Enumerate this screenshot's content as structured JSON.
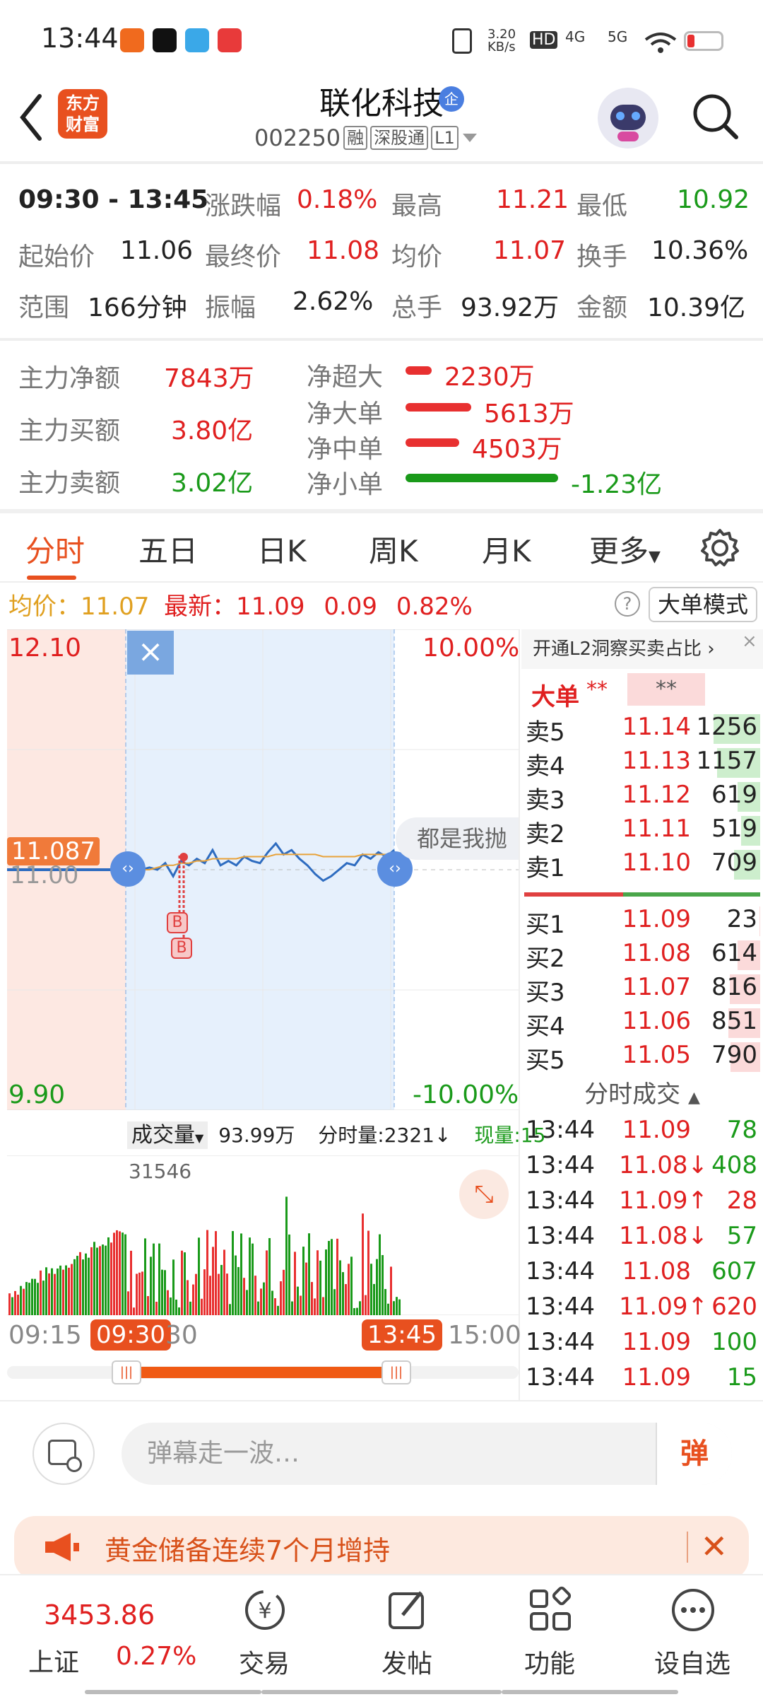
{
  "status_bar": {
    "time": "13:44",
    "speed": "3.20\nKB/s",
    "network": "4G",
    "network2": "5G"
  },
  "header": {
    "back_icon": "chevron-left-icon",
    "logo_text": "东方\n财富",
    "stock_name": "联化科技",
    "qi_badge": "企",
    "stock_code": "002250",
    "tags": [
      "融",
      "深股通",
      "L1"
    ],
    "search_icon": "search-icon"
  },
  "range_info": {
    "time_range": "09:30 - 13:45",
    "rows": [
      [
        {
          "label": "涨跌幅",
          "value": "0.18%",
          "color": "red"
        },
        {
          "label": "最高",
          "value": "11.21",
          "color": "red"
        },
        {
          "label": "最低",
          "value": "10.92",
          "color": "green"
        }
      ],
      [
        {
          "label": "起始价",
          "value": "11.06",
          "color": "dark"
        },
        {
          "label": "最终价",
          "value": "11.08",
          "color": "red"
        },
        {
          "label": "均价",
          "value": "11.07",
          "color": "red"
        },
        {
          "label": "换手",
          "value": "10.36%",
          "color": "dark"
        }
      ],
      [
        {
          "label": "范围",
          "value": "166分钟",
          "color": "dark"
        },
        {
          "label": "振幅",
          "value": "2.62%",
          "color": "dark"
        },
        {
          "label": "总手",
          "value": "93.92万",
          "color": "dark"
        },
        {
          "label": "金额",
          "value": "10.39亿",
          "color": "dark"
        }
      ]
    ]
  },
  "capital_flow": {
    "main_net_label": "主力净额",
    "main_net": "7843万",
    "main_buy_label": "主力买额",
    "main_buy": "3.80亿",
    "main_sell_label": "主力卖额",
    "main_sell": "3.02亿",
    "bars": [
      {
        "label": "净超大",
        "value": "2230万",
        "color": "#e83030",
        "level": 0.17
      },
      {
        "label": "净大单",
        "value": "5613万",
        "color": "#e83030",
        "level": 0.43
      },
      {
        "label": "净中单",
        "value": "4503万",
        "color": "#e83030",
        "level": 0.35
      },
      {
        "label": "净小单",
        "value": "-1.23亿",
        "color": "#1a9a1a",
        "level": 1.0
      }
    ]
  },
  "tabs": [
    "分时",
    "五日",
    "日K",
    "周K",
    "月K",
    "更多"
  ],
  "active_tab": "分时",
  "settings_icon": "gear-icon",
  "quote_line": {
    "avg_label": "均价：",
    "avg_value": "11.07",
    "latest_label": "最新：",
    "latest_value": "11.09",
    "change": "0.09",
    "change_pct": "0.82%",
    "big_order_mode": "大单模式"
  },
  "chart": {
    "y_top": "12.10",
    "y_bottom": "9.90",
    "pct_top": "10.00%",
    "pct_bottom": "-10.00%",
    "current_price_tag": "11.087",
    "mid_price": "11.00",
    "tooltip": "都是我抛",
    "buy_markers": [
      "B",
      "B"
    ]
  },
  "chart_data": {
    "type": "line",
    "title": "",
    "series": [
      {
        "values": [
          11.0,
          11.0,
          11.0,
          11.01,
          11.0,
          11.03,
          10.97,
          11.04,
          11.02,
          11.05,
          11.03,
          11.09,
          11.02,
          11.04,
          11.02,
          11.06,
          11.04,
          11.03,
          11.08,
          11.12,
          11.07,
          11.09,
          11.05,
          11.02,
          10.98,
          10.95,
          10.97,
          11.0,
          11.03,
          11.02,
          11.07,
          11.05,
          11.08,
          11.06,
          11.09
        ]
      },
      {
        "values": [
          11.0,
          11.0,
          11.0,
          11.0,
          11.01,
          11.02,
          11.02,
          11.03,
          11.03,
          11.04,
          11.04,
          11.05,
          11.05,
          11.05,
          11.05,
          11.06,
          11.06,
          11.06,
          11.06,
          11.07,
          11.07,
          11.07,
          11.07,
          11.07,
          11.07,
          11.06,
          11.06,
          11.06,
          11.06,
          11.06,
          11.07,
          11.07,
          11.07,
          11.07,
          11.07
        ]
      }
    ],
    "ylim": [
      9.9,
      12.1
    ]
  },
  "volume": {
    "label": "成交量",
    "total": "93.99万",
    "tick_vol_label": "分时量:2321↓",
    "now_vol_label": "现量:15",
    "peak_label": "31546",
    "expand_icon": "expand-icon"
  },
  "time_axis": {
    "start": "09:15",
    "sel_start": "09:30",
    "sel_start_tail": "30",
    "sel_end": "13:45",
    "end": "15:00"
  },
  "order_book": {
    "l2_banner": "开通L2洞察买卖占比",
    "big_label": "大单",
    "big_value1": "**",
    "big_value2": "**",
    "asks": [
      {
        "label": "卖5",
        "price": "11.14",
        "vol": "1256",
        "level": 1.0
      },
      {
        "label": "卖4",
        "price": "11.13",
        "vol": "1157",
        "level": 0.92
      },
      {
        "label": "卖3",
        "price": "11.12",
        "vol": "619",
        "level": 0.49
      },
      {
        "label": "卖2",
        "price": "11.11",
        "vol": "519",
        "level": 0.41
      },
      {
        "label": "卖1",
        "price": "11.10",
        "vol": "709",
        "level": 0.56
      }
    ],
    "bids": [
      {
        "label": "买1",
        "price": "11.09",
        "vol": "23",
        "level": 0.02
      },
      {
        "label": "买2",
        "price": "11.08",
        "vol": "614",
        "level": 0.49
      },
      {
        "label": "买3",
        "price": "11.07",
        "vol": "816",
        "level": 0.65
      },
      {
        "label": "买4",
        "price": "11.06",
        "vol": "851",
        "level": 0.68
      },
      {
        "label": "买5",
        "price": "11.05",
        "vol": "790",
        "level": 0.63
      }
    ],
    "trades_header": "分时成交",
    "trades": [
      {
        "time": "13:44",
        "price": "11.09",
        "arrow": "",
        "vol": "78",
        "vcolor": "green"
      },
      {
        "time": "13:44",
        "price": "11.08",
        "arrow": "↓",
        "vol": "408",
        "vcolor": "green"
      },
      {
        "time": "13:44",
        "price": "11.09",
        "arrow": "↑",
        "vol": "28",
        "vcolor": "red"
      },
      {
        "time": "13:44",
        "price": "11.08",
        "arrow": "↓",
        "vol": "57",
        "vcolor": "green"
      },
      {
        "time": "13:44",
        "price": "11.08",
        "arrow": "",
        "vol": "607",
        "vcolor": "green"
      },
      {
        "time": "13:44",
        "price": "11.09",
        "arrow": "↑",
        "vol": "620",
        "vcolor": "red"
      },
      {
        "time": "13:44",
        "price": "11.09",
        "arrow": "",
        "vol": "100",
        "vcolor": "green"
      },
      {
        "time": "13:44",
        "price": "11.09",
        "arrow": "",
        "vol": "15",
        "vcolor": "green"
      }
    ]
  },
  "comment": {
    "placeholder": "弹幕走一波…",
    "send_label": "弹"
  },
  "news": {
    "text": "黄金储备连续7个月增持"
  },
  "bottom_nav": {
    "index_value": "3453.86",
    "index_name": "上证",
    "index_change": "0.27%",
    "items": [
      "交易",
      "发帖",
      "功能",
      "设自选"
    ]
  }
}
